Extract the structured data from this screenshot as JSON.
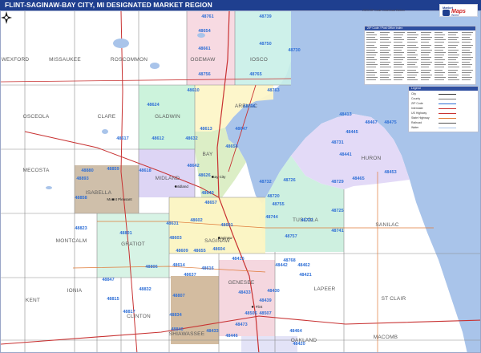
{
  "title": "FLINT-SAGINAW-BAY CITY, MI DESIGNATED MARKET REGION",
  "copyright": "2023 ZIP Code Color/Cast Edition",
  "logo": {
    "top_text": "Market",
    "main_text": "Maps",
    "sub_text": "World"
  },
  "zip_index": {
    "header": "ZIP Code / Post Office Index"
  },
  "legend": {
    "header": "Legend",
    "rows": [
      {
        "label": "City",
        "color": "#333333"
      },
      {
        "label": "County",
        "color": "#777777"
      },
      {
        "label": "ZIP Code",
        "color": "#2f6fd6"
      },
      {
        "label": "Interstate",
        "color": "#c83232"
      },
      {
        "label": "US Highway",
        "color": "#c83232"
      },
      {
        "label": "State Highway",
        "color": "#e07b39"
      },
      {
        "label": "Railroad",
        "color": "#555555"
      },
      {
        "label": "Water",
        "color": "#a9c4ea"
      }
    ]
  },
  "colors": {
    "water": "#a9c4ea",
    "land": "#ffffff",
    "title_bar": "#1f3f8f",
    "zip_text": "#2f6fd6",
    "highway": "#c83232"
  },
  "counties": [
    {
      "name": "WEXFORD"
    },
    {
      "name": "MISSAUKEE"
    },
    {
      "name": "ROSCOMMON"
    },
    {
      "name": "OGEMAW"
    },
    {
      "name": "IOSCO"
    },
    {
      "name": "OSCEOLA"
    },
    {
      "name": "CLARE"
    },
    {
      "name": "GLADWIN"
    },
    {
      "name": "ARENAC"
    },
    {
      "name": "HURON"
    },
    {
      "name": "MECOSTA"
    },
    {
      "name": "ISABELLA"
    },
    {
      "name": "MIDLAND"
    },
    {
      "name": "BAY"
    },
    {
      "name": "TUSCOLA"
    },
    {
      "name": "SANILAC"
    },
    {
      "name": "MONTCALM"
    },
    {
      "name": "GRATIOT"
    },
    {
      "name": "SAGINAW"
    },
    {
      "name": "IONIA"
    },
    {
      "name": "KENT"
    },
    {
      "name": "CLINTON"
    },
    {
      "name": "SHIAWASSEE"
    },
    {
      "name": "GENESEE"
    },
    {
      "name": "LAPEER"
    },
    {
      "name": "ST CLAIR"
    },
    {
      "name": "MACOMB"
    },
    {
      "name": "OAKLAND"
    }
  ],
  "zips": [
    "48761",
    "48654",
    "48661",
    "48756",
    "48739",
    "48750",
    "48730",
    "48765",
    "48763",
    "48610",
    "48624",
    "48613",
    "48612",
    "48617",
    "48632",
    "48642",
    "48618",
    "48640",
    "48658",
    "48647",
    "48657",
    "48626",
    "48631",
    "48880",
    "48893",
    "48859",
    "48858",
    "48823",
    "48602",
    "48601",
    "48706",
    "48732",
    "48720",
    "48755",
    "48744",
    "48741",
    "48757",
    "48768",
    "48722",
    "48725",
    "48726",
    "48729",
    "48413",
    "48467",
    "48475",
    "48445",
    "48731",
    "48441",
    "48465",
    "48453",
    "48603",
    "48604",
    "48609",
    "48614",
    "48637",
    "48655",
    "48616",
    "48415",
    "48462",
    "48421",
    "48433",
    "48439",
    "48505",
    "48507",
    "48473",
    "48430",
    "48442",
    "48464",
    "48420",
    "48832",
    "48801",
    "48806",
    "48847",
    "48807",
    "48834",
    "48815",
    "48817",
    "48840",
    "48433",
    "48446"
  ],
  "cities": [
    {
      "name": "Bay City"
    },
    {
      "name": "Saginaw"
    },
    {
      "name": "Flint"
    },
    {
      "name": "Midland"
    },
    {
      "name": "Mount Pleasant"
    }
  ]
}
